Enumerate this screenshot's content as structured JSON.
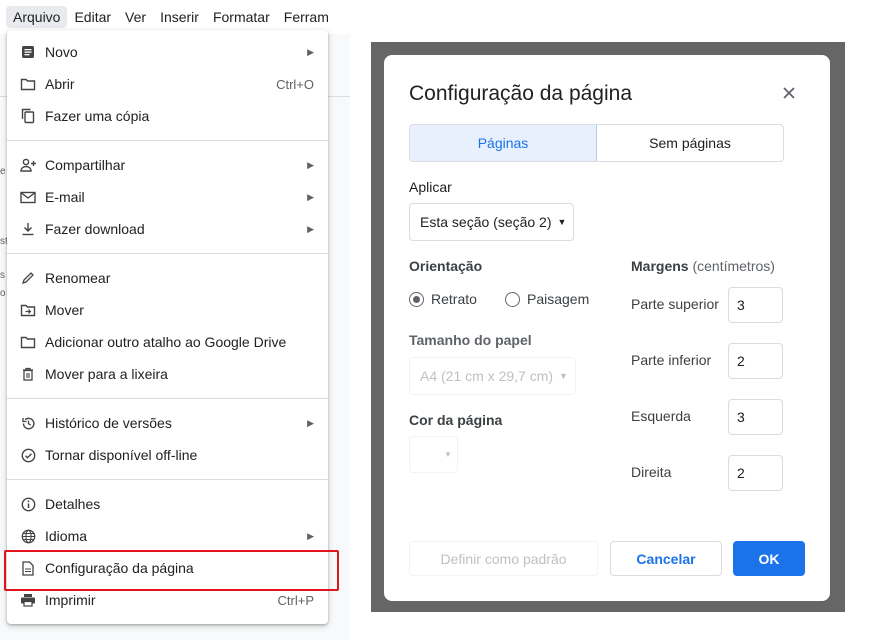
{
  "menubar": {
    "items": [
      "Arquivo",
      "Editar",
      "Ver",
      "Inserir",
      "Formatar",
      "Ferram"
    ]
  },
  "background_fragments": [
    "e",
    "s",
    "o",
    "st"
  ],
  "file_menu": {
    "items": [
      {
        "label": "Novo",
        "icon": "new-document-icon",
        "shortcut": "",
        "submenu": true
      },
      {
        "label": "Abrir",
        "icon": "folder-icon",
        "shortcut": "Ctrl+O",
        "submenu": false
      },
      {
        "label": "Fazer uma cópia",
        "icon": "copy-icon",
        "shortcut": "",
        "submenu": false
      },
      {
        "label": "Compartilhar",
        "icon": "person-add-icon",
        "shortcut": "",
        "submenu": true
      },
      {
        "label": "E-mail",
        "icon": "mail-icon",
        "shortcut": "",
        "submenu": true
      },
      {
        "label": "Fazer download",
        "icon": "download-icon",
        "shortcut": "",
        "submenu": true
      },
      {
        "label": "Renomear",
        "icon": "rename-icon",
        "shortcut": "",
        "submenu": false
      },
      {
        "label": "Mover",
        "icon": "move-folder-icon",
        "shortcut": "",
        "submenu": false
      },
      {
        "label": "Adicionar outro atalho ao Google Drive",
        "icon": "drive-shortcut-icon",
        "shortcut": "",
        "submenu": false
      },
      {
        "label": "Mover para a lixeira",
        "icon": "trash-icon",
        "shortcut": "",
        "submenu": false
      },
      {
        "label": "Histórico de versões",
        "icon": "history-icon",
        "shortcut": "",
        "submenu": true
      },
      {
        "label": "Tornar disponível off-line",
        "icon": "offline-check-icon",
        "shortcut": "",
        "submenu": false
      },
      {
        "label": "Detalhes",
        "icon": "info-icon",
        "shortcut": "",
        "submenu": false
      },
      {
        "label": "Idioma",
        "icon": "globe-icon",
        "shortcut": "",
        "submenu": true
      },
      {
        "label": "Configuração da página",
        "icon": "page-setup-icon",
        "shortcut": "",
        "submenu": false,
        "highlighted": true
      },
      {
        "label": "Imprimir",
        "icon": "printer-icon",
        "shortcut": "Ctrl+P",
        "submenu": false
      }
    ],
    "highlight_color": "#e0141c"
  },
  "dialog": {
    "title": "Configuração da página",
    "tabs": [
      {
        "label": "Páginas",
        "selected": true
      },
      {
        "label": "Sem páginas",
        "selected": false
      }
    ],
    "apply_label": "Aplicar",
    "apply_value": "Esta seção (seção 2)",
    "orientation_label": "Orientação",
    "orientation_options": [
      {
        "label": "Retrato",
        "checked": true
      },
      {
        "label": "Paisagem",
        "checked": false
      }
    ],
    "paper_size_label": "Tamanho do papel",
    "paper_size_value": "A4 (21 cm x 29,7 cm)",
    "page_color_label": "Cor da página",
    "margins_label": "Margens",
    "margins_unit": "(centímetros)",
    "margins": [
      {
        "label": "Parte superior",
        "value": "3"
      },
      {
        "label": "Parte inferior",
        "value": "2"
      },
      {
        "label": "Esquerda",
        "value": "3"
      },
      {
        "label": "Direita",
        "value": "2"
      }
    ],
    "buttons": {
      "default": "Definir como padrão",
      "cancel": "Cancelar",
      "ok": "OK"
    },
    "accent_color": "#1a73e8"
  }
}
